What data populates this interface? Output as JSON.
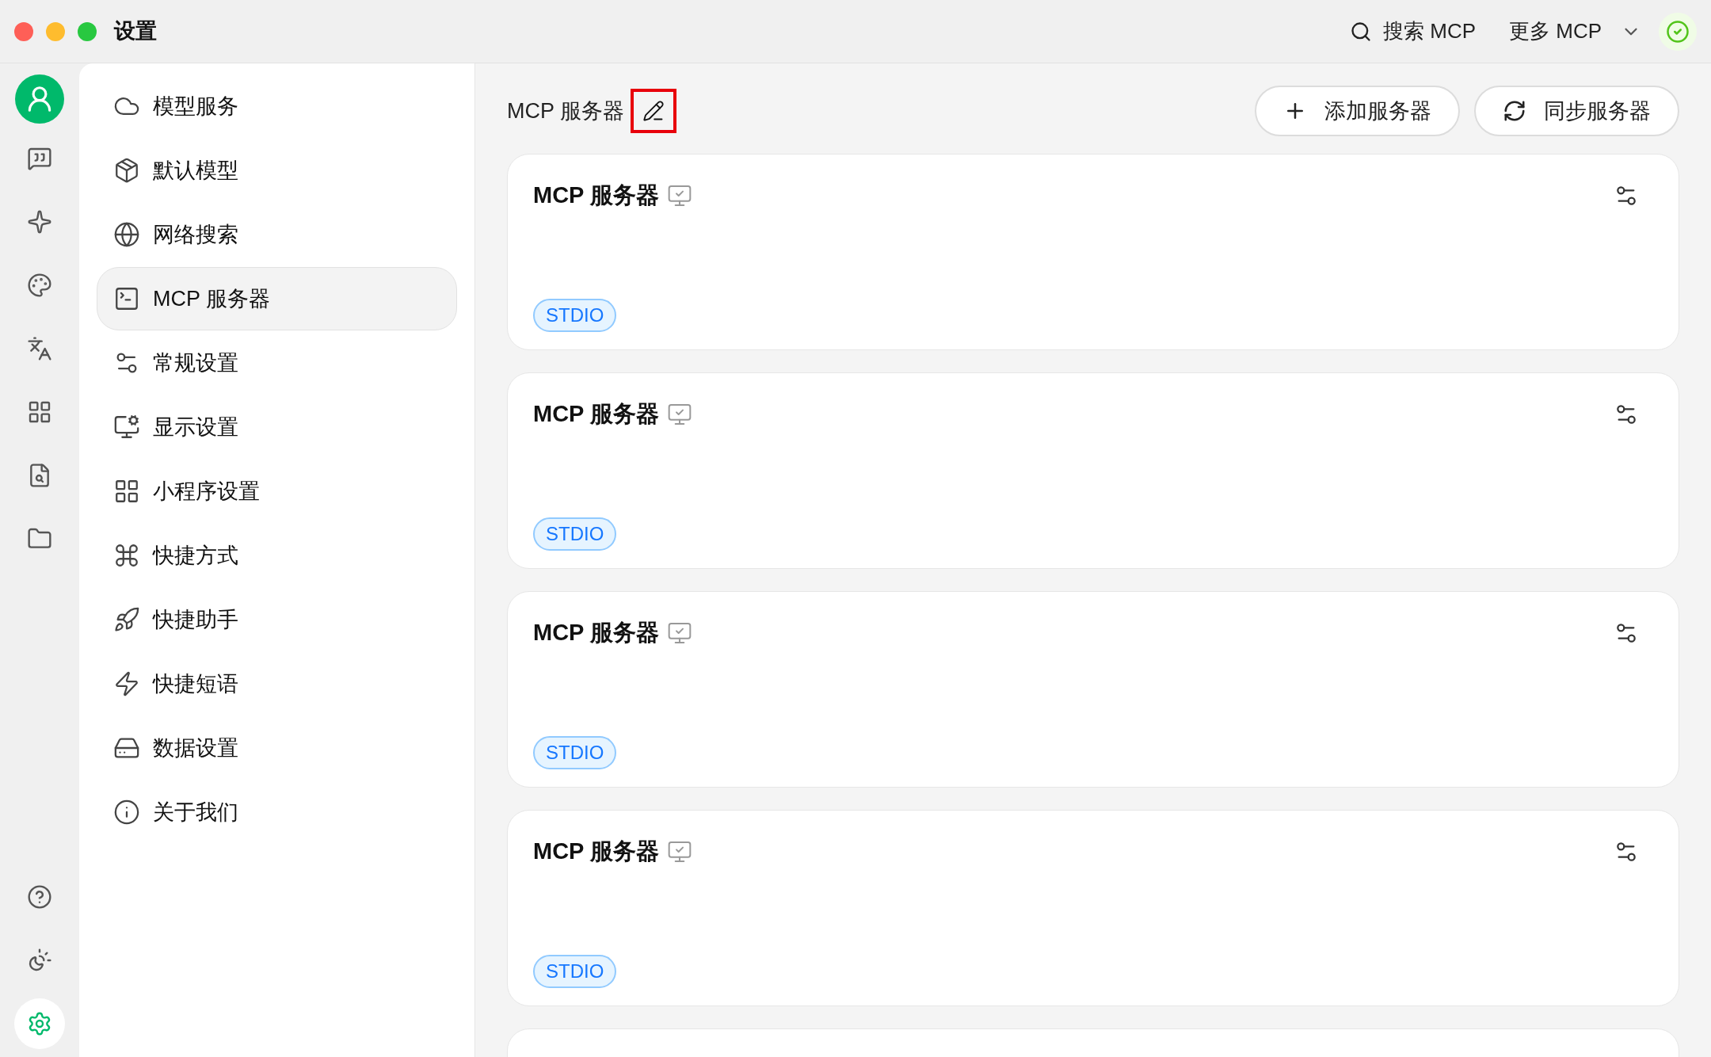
{
  "window": {
    "title": "设置"
  },
  "toolbar": {
    "search": "搜索 MCP",
    "more": "更多 MCP",
    "status_ok": true
  },
  "rail": {
    "items": [
      {
        "kind": "chat",
        "selected": false
      },
      {
        "kind": "sparkle",
        "selected": false
      },
      {
        "kind": "palette",
        "selected": false
      },
      {
        "kind": "translate",
        "selected": false
      },
      {
        "kind": "apps",
        "selected": false
      },
      {
        "kind": "doc-search",
        "selected": false
      },
      {
        "kind": "folder",
        "selected": false
      }
    ],
    "bottom": [
      {
        "kind": "help",
        "selected": false
      },
      {
        "kind": "theme",
        "selected": false
      },
      {
        "kind": "settings",
        "selected": true
      }
    ]
  },
  "sidebar": {
    "items": [
      {
        "kind": "cloud",
        "label": "模型服务",
        "selected": false
      },
      {
        "kind": "box",
        "label": "默认模型",
        "selected": false
      },
      {
        "kind": "globe",
        "label": "网络搜索",
        "selected": false
      },
      {
        "kind": "terminal",
        "label": "MCP 服务器",
        "selected": true
      },
      {
        "kind": "sliders",
        "label": "常规设置",
        "selected": false
      },
      {
        "kind": "monitor",
        "label": "显示设置",
        "selected": false
      },
      {
        "kind": "apps",
        "label": "小程序设置",
        "selected": false
      },
      {
        "kind": "command",
        "label": "快捷方式",
        "selected": false
      },
      {
        "kind": "rocket",
        "label": "快捷助手",
        "selected": false
      },
      {
        "kind": "zap",
        "label": "快捷短语",
        "selected": false
      },
      {
        "kind": "drive",
        "label": "数据设置",
        "selected": false
      },
      {
        "kind": "info",
        "label": "关于我们",
        "selected": false
      }
    ]
  },
  "main": {
    "title": "MCP 服务器",
    "edit_highlighted": true,
    "buttons": [
      {
        "kind": "add",
        "label": "添加服务器"
      },
      {
        "kind": "sync",
        "label": "同步服务器"
      }
    ],
    "servers": [
      {
        "name": "MCP 服务器",
        "tag": "STDIO"
      },
      {
        "name": "MCP 服务器",
        "tag": "STDIO"
      },
      {
        "name": "MCP 服务器",
        "tag": "STDIO"
      },
      {
        "name": "MCP 服务器",
        "tag": "STDIO"
      }
    ]
  }
}
